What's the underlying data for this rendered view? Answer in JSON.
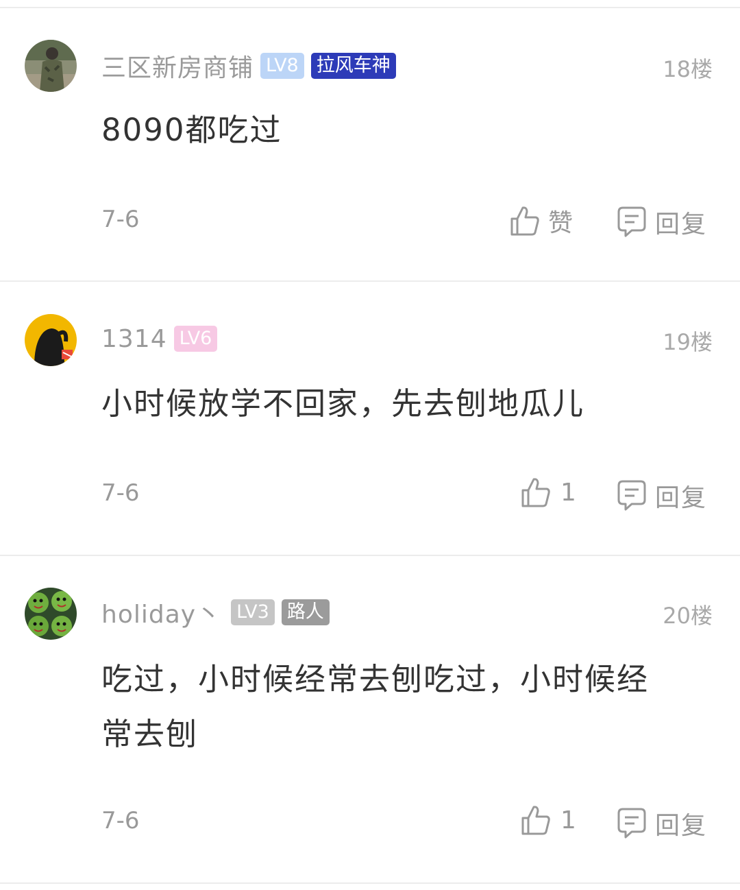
{
  "comments": [
    {
      "username": "三区新房商铺",
      "level": "LV8",
      "title": "拉风车神",
      "floor": "18楼",
      "content": "8090都吃过",
      "date": "7-6",
      "like_label": "赞",
      "reply_label": "回复"
    },
    {
      "username": "1314",
      "level": "LV6",
      "floor": "19楼",
      "content": "小时候放学不回家，先去刨地瓜儿",
      "date": "7-6",
      "like_count": "1",
      "reply_label": "回复"
    },
    {
      "username": "holiday丶",
      "level": "LV3",
      "title": "路人",
      "floor": "20楼",
      "content": "吃过，小时候经常去刨吃过，小时候经常去刨",
      "date": "7-6",
      "like_count": "1",
      "reply_label": "回复"
    }
  ],
  "colors": {
    "level_badge_1": "#bcd5f7",
    "level_badge_2": "#f7c9e4",
    "level_badge_3": "#c5c5c5",
    "title_badge_1": "#2d3bb8",
    "title_badge_3": "#9b9b9b",
    "divider": "#ececec"
  },
  "icons": {
    "like": "thumbs-up-icon",
    "reply": "speech-bubble-icon"
  }
}
